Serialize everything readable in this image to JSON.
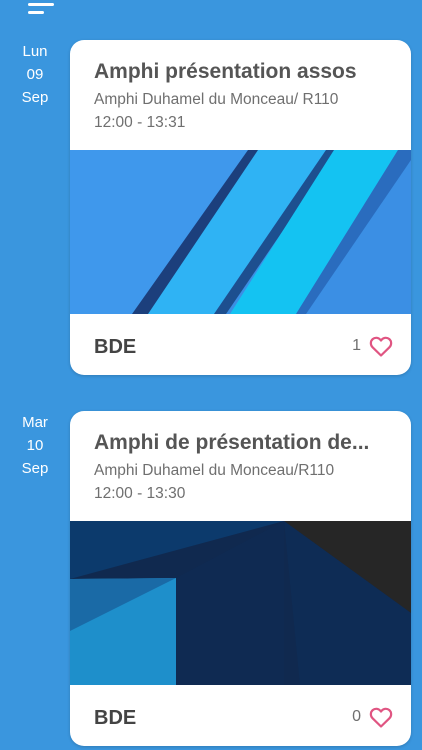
{
  "menu_icon": "hamburger-menu-icon",
  "events": [
    {
      "day_name": "Lun",
      "day_num": "09",
      "month": "Sep",
      "title": "Amphi présentation assos",
      "location": "Amphi Duhamel du Monceau/ R110",
      "time": "12:00 - 13:31",
      "organizer": "BDE",
      "likes": "1",
      "like_icon": "heart-outline-icon"
    },
    {
      "day_name": "Mar",
      "day_num": "10",
      "month": "Sep",
      "title": "Amphi de présentation de...",
      "location": "Amphi Duhamel du Monceau/R110",
      "time": "12:00 - 13:30",
      "organizer": "BDE",
      "likes": "0",
      "like_icon": "heart-outline-icon"
    }
  ],
  "colors": {
    "background": "#3a96de",
    "card": "#ffffff",
    "heart": "#e05582",
    "title_text": "#555555",
    "meta_text": "#6f6f6f"
  }
}
